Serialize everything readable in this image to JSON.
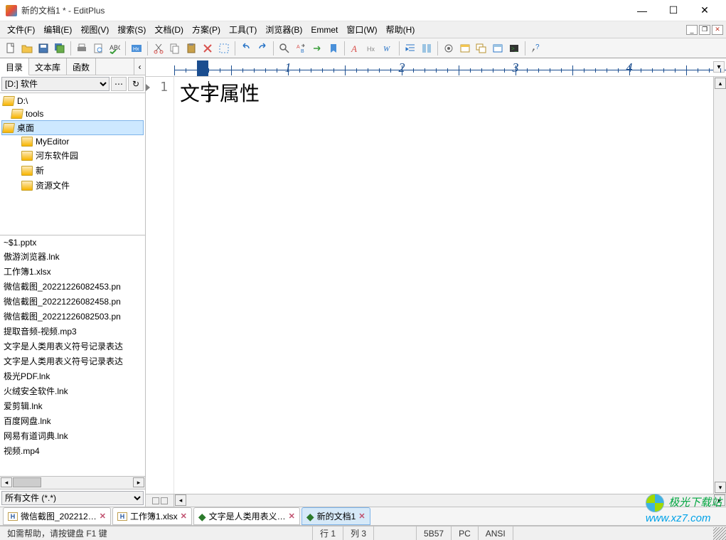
{
  "window": {
    "title": "新的文档1 * - EditPlus"
  },
  "menu": {
    "file": "文件(F)",
    "edit": "编辑(E)",
    "view": "视图(V)",
    "search": "搜索(S)",
    "document": "文档(D)",
    "project": "方案(P)",
    "tools": "工具(T)",
    "browser": "浏览器(B)",
    "emmet": "Emmet",
    "window": "窗口(W)",
    "help": "帮助(H)"
  },
  "sidebar": {
    "tabs": {
      "directory": "目录",
      "textlib": "文本库",
      "functions": "函数"
    },
    "drive": "[D:] 软件",
    "tree": [
      {
        "label": "D:\\",
        "indent": 0,
        "open": true
      },
      {
        "label": "tools",
        "indent": 1,
        "open": true
      },
      {
        "label": "桌面",
        "indent": 2,
        "open": true,
        "selected": true
      },
      {
        "label": "MyEditor",
        "indent": 2
      },
      {
        "label": "河东软件园",
        "indent": 2
      },
      {
        "label": "新",
        "indent": 2
      },
      {
        "label": "资源文件",
        "indent": 2
      }
    ],
    "files": [
      "~$1.pptx",
      "傲游浏览器.lnk",
      "工作簿1.xlsx",
      "微信截图_20221226082453.pn",
      "微信截图_20221226082458.pn",
      "微信截图_20221226082503.pn",
      "提取音频-视频.mp3",
      "文字是人类用表义符号记录表达",
      "文字是人类用表义符号记录表达",
      "极光PDF.lnk",
      "火绒安全软件.lnk",
      "爱剪辑.lnk",
      "百度网盘.lnk",
      "网易有道词典.lnk",
      "视频.mp4"
    ],
    "filter": "所有文件 (*.*)"
  },
  "editor": {
    "line_number": "1",
    "content": "文字属性",
    "ruler_numbers": [
      "1",
      "2",
      "3",
      "4"
    ]
  },
  "doctabs": [
    {
      "label": "微信截图_202212…",
      "icon": "h",
      "active": false
    },
    {
      "label": "工作簿1.xlsx",
      "icon": "h",
      "active": false
    },
    {
      "label": "文字是人类用表义…",
      "icon": "dot",
      "active": false
    },
    {
      "label": "新的文档1",
      "icon": "dot",
      "active": true
    }
  ],
  "status": {
    "help": "如需帮助，请按键盘 F1 键",
    "line": "行 1",
    "col": "列 3",
    "code": "5B57",
    "mode": "PC",
    "enc": "ANSI"
  },
  "watermark": {
    "brand": "极光下载站",
    "url": "www.xz7.com"
  }
}
